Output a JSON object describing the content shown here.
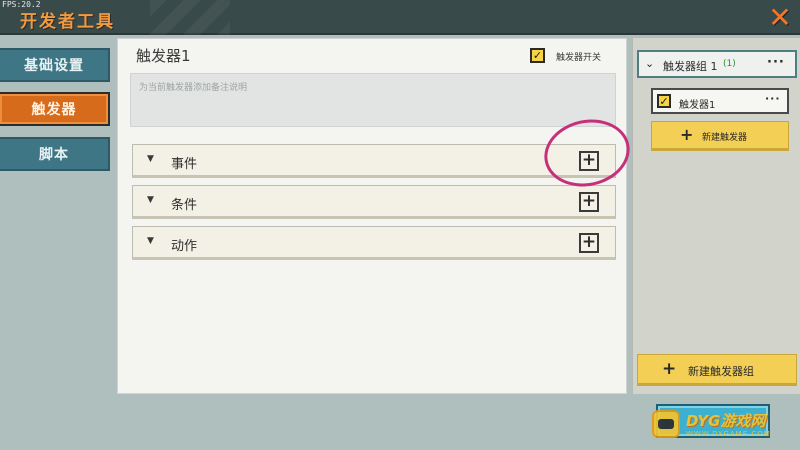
{
  "window": {
    "fps": "FPS:20.2",
    "title": "开发者工具",
    "close_symbol": "✕"
  },
  "sidebar": {
    "items": [
      {
        "label": "基础设置",
        "active": false
      },
      {
        "label": "触发器",
        "active": true
      },
      {
        "label": "脚本",
        "active": false
      }
    ]
  },
  "main": {
    "trigger_name": "触发器1",
    "switch_label": "触发器开关",
    "switch_checked": true,
    "description_placeholder": "为当前触发器添加备注说明",
    "sections": [
      {
        "label": "事件"
      },
      {
        "label": "条件"
      },
      {
        "label": "动作"
      }
    ]
  },
  "right": {
    "group_name": "触发器组 1",
    "group_count": "(1)",
    "triggers": [
      {
        "name": "触发器1",
        "checked": true
      }
    ],
    "new_trigger_label": "新建触发器",
    "new_group_label": "新建触发器组"
  },
  "watermark": {
    "text": "DYG游戏网",
    "sub": "WWW.DYGAME.COM"
  },
  "colors": {
    "accent_orange": "#d66b1c",
    "sidebar_teal": "#3f7685",
    "button_yellow": "#f4cf55",
    "annotation_pink": "#c6307a"
  }
}
